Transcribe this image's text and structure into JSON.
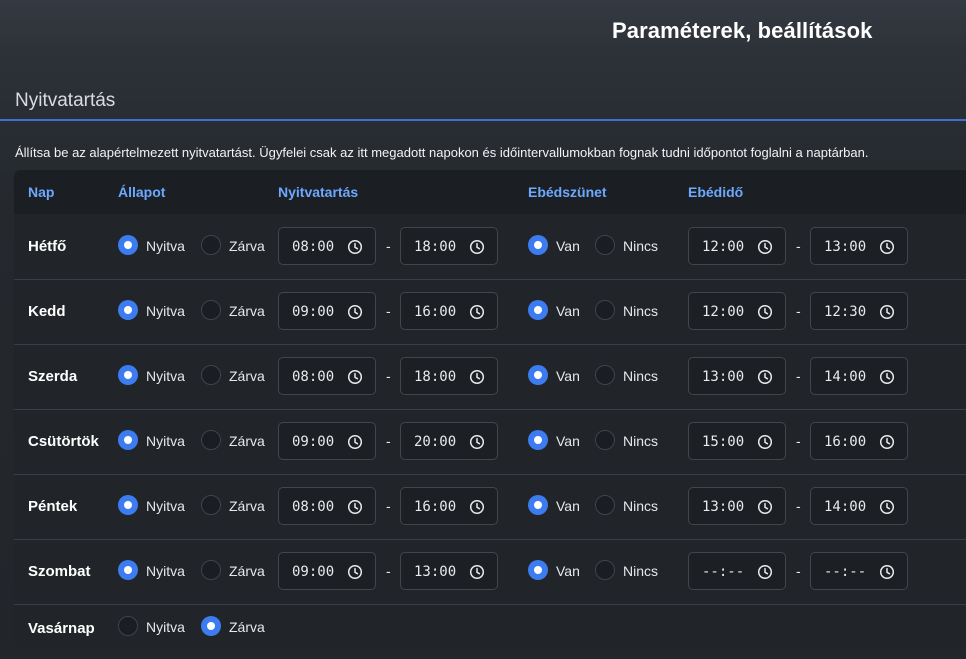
{
  "page": {
    "title": "Paraméterek, beállítások"
  },
  "section": {
    "title": "Nyitvatartás",
    "description": "Állítsa be az alapértelmezett nyitvatartást. Ügyfelei csak az itt megadott napokon és időintervallumokban fognak tudni időpontot foglalni a naptárban."
  },
  "table": {
    "headers": {
      "day": "Nap",
      "status": "Állapot",
      "hours": "Nyitvatartás",
      "lunch": "Ebédszünet",
      "lunch_time": "Ebédidő"
    },
    "labels": {
      "open": "Nyitva",
      "closed": "Zárva",
      "yes": "Van",
      "no": "Nincs",
      "separator": "-"
    },
    "rows": [
      {
        "day": "Hétfő",
        "status": "open",
        "open_from": "08:00",
        "open_to": "18:00",
        "lunch": "yes",
        "lunch_from": "12:00",
        "lunch_to": "13:00"
      },
      {
        "day": "Kedd",
        "status": "open",
        "open_from": "09:00",
        "open_to": "16:00",
        "lunch": "yes",
        "lunch_from": "12:00",
        "lunch_to": "12:30"
      },
      {
        "day": "Szerda",
        "status": "open",
        "open_from": "08:00",
        "open_to": "18:00",
        "lunch": "yes",
        "lunch_from": "13:00",
        "lunch_to": "14:00"
      },
      {
        "day": "Csütörtök",
        "status": "open",
        "open_from": "09:00",
        "open_to": "20:00",
        "lunch": "yes",
        "lunch_from": "15:00",
        "lunch_to": "16:00"
      },
      {
        "day": "Péntek",
        "status": "open",
        "open_from": "08:00",
        "open_to": "16:00",
        "lunch": "yes",
        "lunch_from": "13:00",
        "lunch_to": "14:00"
      },
      {
        "day": "Szombat",
        "status": "open",
        "open_from": "09:00",
        "open_to": "13:00",
        "lunch": "yes",
        "lunch_from": "--:--",
        "lunch_to": "--:--"
      },
      {
        "day": "Vasárnap",
        "status": "closed"
      }
    ]
  },
  "icons": {
    "time": "clock-icon"
  },
  "colors": {
    "accent": "#3d7cf0",
    "header_text": "#6ea8fe",
    "rule": "#3f6fd0"
  }
}
